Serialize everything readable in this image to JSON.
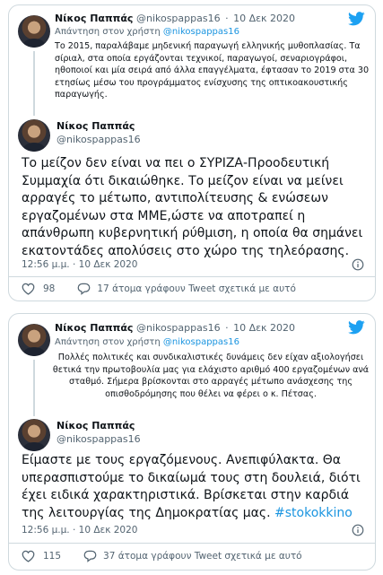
{
  "colors": {
    "accent": "#1b95e0",
    "text": "#0f1419",
    "muted": "#536471",
    "border": "#cfd9de"
  },
  "tweets": [
    {
      "quoted": {
        "author_name": "Νίκος Παππάς",
        "author_handle": "@nikospappas16",
        "separator": "·",
        "date": "10 Δεκ 2020",
        "reply_prefix": "Απάντηση στον χρήστη",
        "reply_to": "@nikospappas16",
        "text": "Το 2015, παραλάβαμε μηδενική παραγωγή ελληνικής μυθοπλασίας. Τα σίριαλ, στα οποία εργάζονται τεχνικοί, παραγωγοί, σεναριογράφοι, ηθοποιοί και μία σειρά από άλλα επαγγέλματα, έφτασαν το 2019 στα 30 ετησίως μέσω του προγράμματος ενίσχυσης της οπτικοακουστικής παραγωγής."
      },
      "author_name": "Νίκος Παππάς",
      "author_handle": "@nikospappas16",
      "text": "Το μείζον δεν είναι να πει ο ΣΥΡΙΖΑ-Προοδευτική Συμμαχία ότι δικαιώθηκε. Το μείζον είναι να μείνει αρραγές το μέτωπο, αντιπολίτευσης & ενώσεων εργαζομένων στα ΜΜΕ,ώστε να αποτραπεί η απάνθρωπη κυβερνητική ρύθμιση, η οποία θα σημάνει εκατοντάδες απολύσεις στο χώρο της τηλεόρασης.",
      "hashtag": "",
      "time": "12:56 μ.μ.",
      "separator": "·",
      "date": "10 Δεκ 2020",
      "likes": "98",
      "talking": "17 άτομα γράφουν Tweet σχετικά με αυτό",
      "icons": {
        "brand": "twitter-bird-icon",
        "like": "heart-icon",
        "reply": "comment-bubble-icon",
        "info": "info-icon"
      }
    },
    {
      "quoted": {
        "author_name": "Νίκος Παππάς",
        "author_handle": "@nikospappas16",
        "separator": "·",
        "date": "10 Δεκ 2020",
        "reply_prefix": "Απάντηση στον χρήστη",
        "reply_to": "@nikospappas16",
        "text": "Πολλές πολιτικές και συνδικαλιστικές δυνάμεις δεν είχαν αξιολογήσει θετικά την πρωτοβουλία μας για ελάχιστο αριθμό 400 εργαζομένων ανά σταθμό. Σήμερα βρίσκονται στο αρραγές μέτωπο ανάσχεσης της οπισθοδρόμησης που θέλει να φέρει ο κ. Πέτσας."
      },
      "author_name": "Νίκος Παππάς",
      "author_handle": "@nikospappas16",
      "text": "Είμαστε με τους εργαζόμενους. Ανεπιφύλακτα. Θα υπερασπιστούμε το δικαίωμά τους στη δουλειά, διότι έχει ειδικά χαρακτηριστικά. Βρίσκεται στην καρδιά της λειτουργίας της Δημοκρατίας μας. ",
      "hashtag": "#stokokkino",
      "time": "12:56 μ.μ.",
      "separator": "·",
      "date": "10 Δεκ 2020",
      "likes": "115",
      "talking": "37 άτομα γράφουν Tweet σχετικά με αυτό",
      "icons": {
        "brand": "twitter-bird-icon",
        "like": "heart-icon",
        "reply": "comment-bubble-icon",
        "info": "info-icon"
      }
    }
  ]
}
